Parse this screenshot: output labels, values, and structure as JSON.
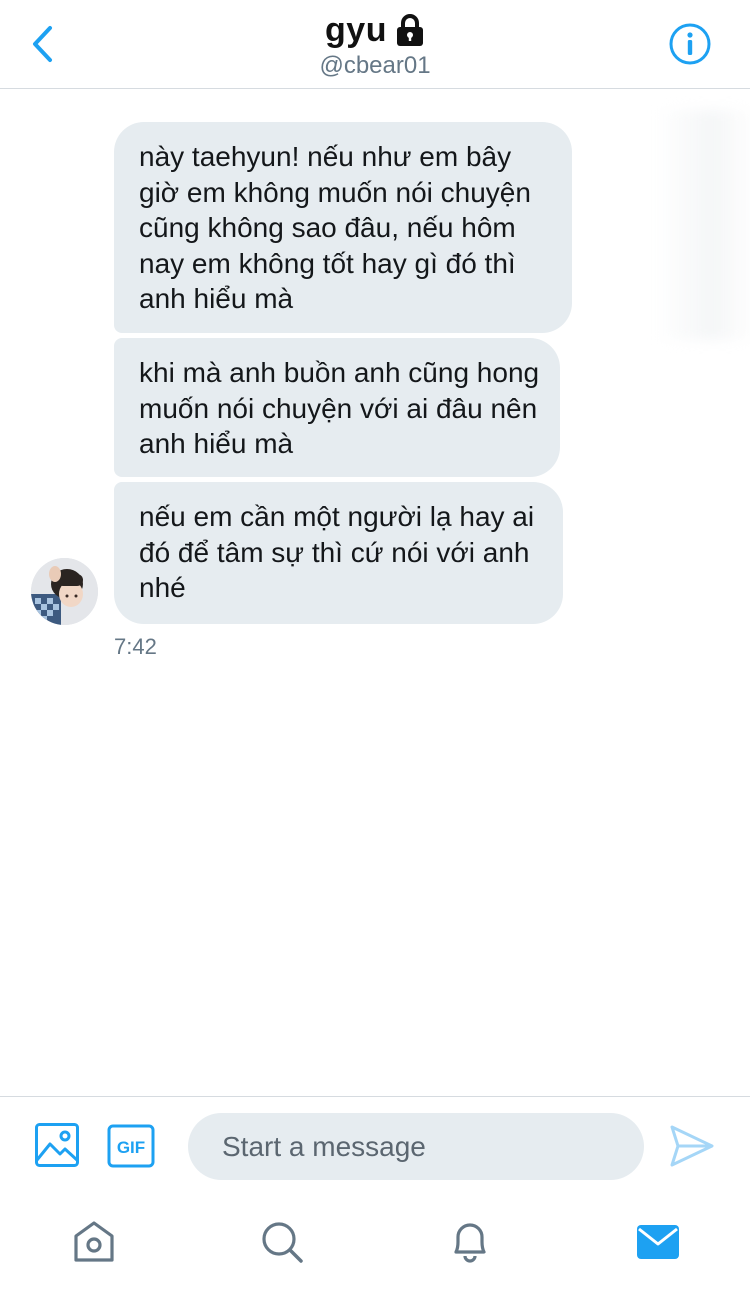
{
  "header": {
    "title": "gyu",
    "handle": "@cbear01",
    "locked_icon": "lock-icon",
    "back_icon": "chevron-left-icon",
    "info_icon": "info-icon"
  },
  "messages": [
    {
      "text": "này taehyun! nếu như em bây giờ em không muốn nói chuyện cũng không sao đâu, nếu hôm nay em không tốt hay gì đó thì anh hiểu mà"
    },
    {
      "text": "khi mà anh buồn anh cũng hong muốn nói chuyện với ai đâu nên anh hiểu mà"
    },
    {
      "text": "nếu em cần một người lạ hay ai đó để tâm sự thì cứ nói với anh nhé"
    }
  ],
  "timestamp": "7:42",
  "composer": {
    "placeholder": "Start a message",
    "value": "",
    "gif_label": "GIF"
  },
  "tabbar": {
    "items": [
      "home-icon",
      "search-icon",
      "bell-icon",
      "mail-icon"
    ],
    "active": "mail-icon"
  },
  "colors": {
    "accent": "#1da1f2",
    "bubble": "#e6ecf0",
    "secondary_text": "#657786"
  }
}
